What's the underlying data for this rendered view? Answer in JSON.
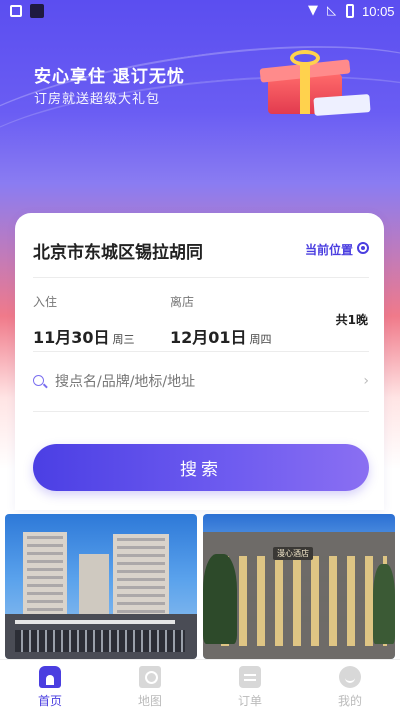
{
  "status_bar": {
    "time": "10:05"
  },
  "banner": {
    "title": "安心享住 退订无忧",
    "subtitle": "订房就送超级大礼包"
  },
  "search_card": {
    "location": "北京市东城区锡拉胡同",
    "current_location_label": "当前位置",
    "checkin": {
      "label": "入住",
      "date": "11月30日",
      "weekday": "周三"
    },
    "checkout": {
      "label": "离店",
      "date": "12月01日",
      "weekday": "周四"
    },
    "nights": "共1晚",
    "search_placeholder": "搜点名/品牌/地标/地址",
    "search_button": "搜索"
  },
  "hotels": [
    {
      "sign": ""
    },
    {
      "sign": "漫心酒店"
    }
  ],
  "tab_bar": {
    "items": [
      {
        "label": "首页",
        "icon": "home-icon",
        "active": true
      },
      {
        "label": "地图",
        "icon": "map-icon",
        "active": false
      },
      {
        "label": "订单",
        "icon": "order-icon",
        "active": false
      },
      {
        "label": "我的",
        "icon": "profile-icon",
        "active": false
      }
    ]
  },
  "colors": {
    "accent": "#4a3ee0",
    "hero_top": "#5b4ef0",
    "hero_mid": "#f07a8a"
  }
}
